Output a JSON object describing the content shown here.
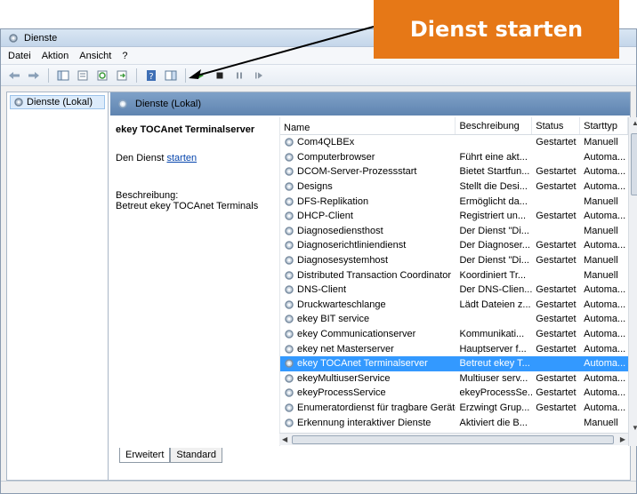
{
  "callout": {
    "text": "Dienst starten"
  },
  "window": {
    "title": "Dienste"
  },
  "menu": [
    "Datei",
    "Aktion",
    "Ansicht",
    "?"
  ],
  "tree": {
    "root": "Dienste (Lokal)"
  },
  "header": {
    "title": "Dienste (Lokal)"
  },
  "detail": {
    "service_name": "ekey TOCAnet Terminalserver",
    "action_prefix": "Den Dienst ",
    "action_link": "starten",
    "desc_label": "Beschreibung:",
    "desc_text": "Betreut ekey TOCAnet Terminals"
  },
  "columns": [
    "Name",
    "Beschreibung",
    "Status",
    "Starttyp"
  ],
  "rows": [
    [
      "Com4QLBEx",
      "",
      "Gestartet",
      "Manuell"
    ],
    [
      "Computerbrowser",
      "Führt eine akt...",
      "",
      "Automa..."
    ],
    [
      "DCOM-Server-Prozessstart",
      "Bietet Startfun...",
      "Gestartet",
      "Automa..."
    ],
    [
      "Designs",
      "Stellt die Desi...",
      "Gestartet",
      "Automa..."
    ],
    [
      "DFS-Replikation",
      "Ermöglicht da...",
      "",
      "Manuell"
    ],
    [
      "DHCP-Client",
      "Registriert un...",
      "Gestartet",
      "Automa..."
    ],
    [
      "Diagnosediensthost",
      "Der Dienst \"Di...",
      "",
      "Manuell"
    ],
    [
      "Diagnoserichtliniendienst",
      "Der Diagnoser...",
      "Gestartet",
      "Automa..."
    ],
    [
      "Diagnosesystemhost",
      "Der Dienst \"Di...",
      "Gestartet",
      "Manuell"
    ],
    [
      "Distributed Transaction Coordinator",
      "Koordiniert Tr...",
      "",
      "Manuell"
    ],
    [
      "DNS-Client",
      "Der DNS-Clien...",
      "Gestartet",
      "Automa..."
    ],
    [
      "Druckwarteschlange",
      "Lädt Dateien z...",
      "Gestartet",
      "Automa..."
    ],
    [
      "ekey BIT service",
      "",
      "Gestartet",
      "Automa..."
    ],
    [
      "ekey Communicationserver",
      "Kommunikati...",
      "Gestartet",
      "Automa..."
    ],
    [
      "ekey net Masterserver",
      "Hauptserver f...",
      "Gestartet",
      "Automa..."
    ],
    [
      "ekey TOCAnet Terminalserver",
      "Betreut ekey T...",
      "",
      "Automa..."
    ],
    [
      "ekeyMultiuserService",
      "Multiuser serv...",
      "Gestartet",
      "Automa..."
    ],
    [
      "ekeyProcessService",
      "ekeyProcessSe...",
      "Gestartet",
      "Automa..."
    ],
    [
      "Enumeratordienst für tragbare Geräte",
      "Erzwingt Grup...",
      "Gestartet",
      "Automa..."
    ],
    [
      "Erkennung interaktiver Dienste",
      "Aktiviert die B...",
      "",
      "Manuell"
    ]
  ],
  "selected_row": 15,
  "tabs": [
    "Erweitert",
    "Standard"
  ],
  "colors": {
    "callout": "#e67817",
    "selection": "#3399ff",
    "header": "#6f93be"
  }
}
